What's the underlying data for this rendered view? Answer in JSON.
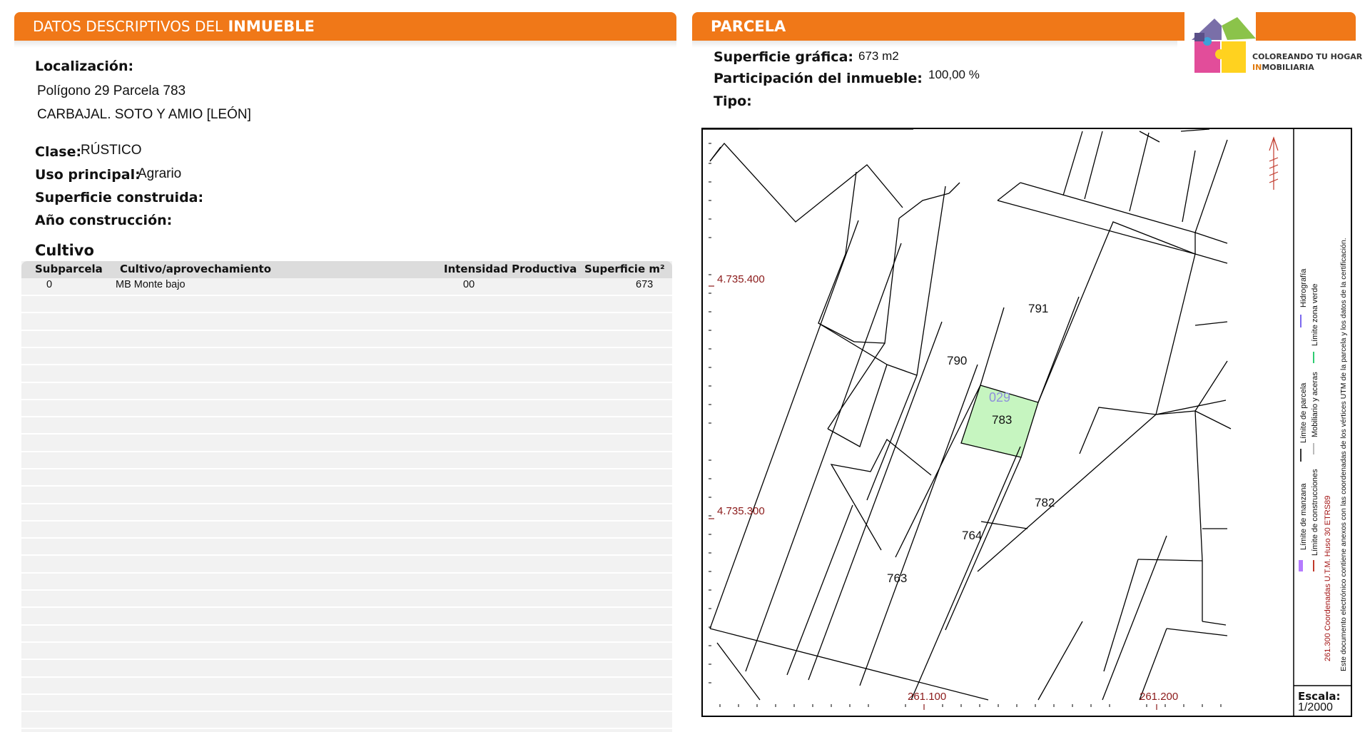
{
  "left_panel": {
    "header_thin": "DATOS DESCRIPTIVOS DEL",
    "header_bold": "INMUEBLE",
    "localizacion_label": "Localización:",
    "localizacion_line1": "Polígono 29 Parcela 783",
    "localizacion_line2": "CARBAJAL. SOTO Y AMIO [LEÓN]",
    "clase_label": "Clase:",
    "clase_value": "RÚSTICO",
    "uso_label": "Uso principal:",
    "uso_value": "Agrario",
    "sup_construida_label": "Superficie construida:",
    "anio_label": "Año construcción:",
    "cultivo_title": "Cultivo",
    "table": {
      "headers": [
        "Subparcela",
        "Cultivo/aprovechamiento",
        "Intensidad Productiva",
        "Superficie m²"
      ],
      "rows": [
        [
          "0",
          "MB Monte bajo",
          "00",
          "673"
        ]
      ]
    }
  },
  "right_panel": {
    "header": "PARCELA",
    "sup_grafica_label": "Superficie gráfica:",
    "sup_grafica_value": "673 m2",
    "participacion_label": "Participación del inmueble:",
    "participacion_value": "100,00 %",
    "tipo_label": "Tipo:",
    "logo": {
      "line1": "COLOREANDO TU HOGAR",
      "line2_accent": "IN",
      "line2_rest": "MOBILIARIA"
    },
    "map": {
      "parcel_labels": [
        "791",
        "790",
        "029",
        "783",
        "782",
        "764",
        "763"
      ],
      "y_coords": [
        "4.735.400",
        "4.735.300"
      ],
      "x_coords": [
        "261.100",
        "261.200"
      ],
      "legend": {
        "limite_manzana": "Límite de manzana",
        "limite_parcela": "Límite de parcela",
        "hidrografia": "Hidrografía",
        "limite_construcciones": "Límite de construcciones",
        "mobiliario": "Mobiliario y aceras",
        "zona_verde": "Límite zona verde",
        "coords_note": "261.300 Coordenadas U.T.M. Huso 30 ETRS89",
        "doc_note": "Este documento electrónico contiene anexos con las coordenadas de los vértices UTM de la parcela y los datos de la certificación."
      },
      "scale_label": "Escala:",
      "scale_value": "1/2000"
    }
  },
  "colors": {
    "band_orange": "#f07818",
    "highlight_green": "#c6f5c0",
    "coord_red": "#8b1a1a"
  }
}
